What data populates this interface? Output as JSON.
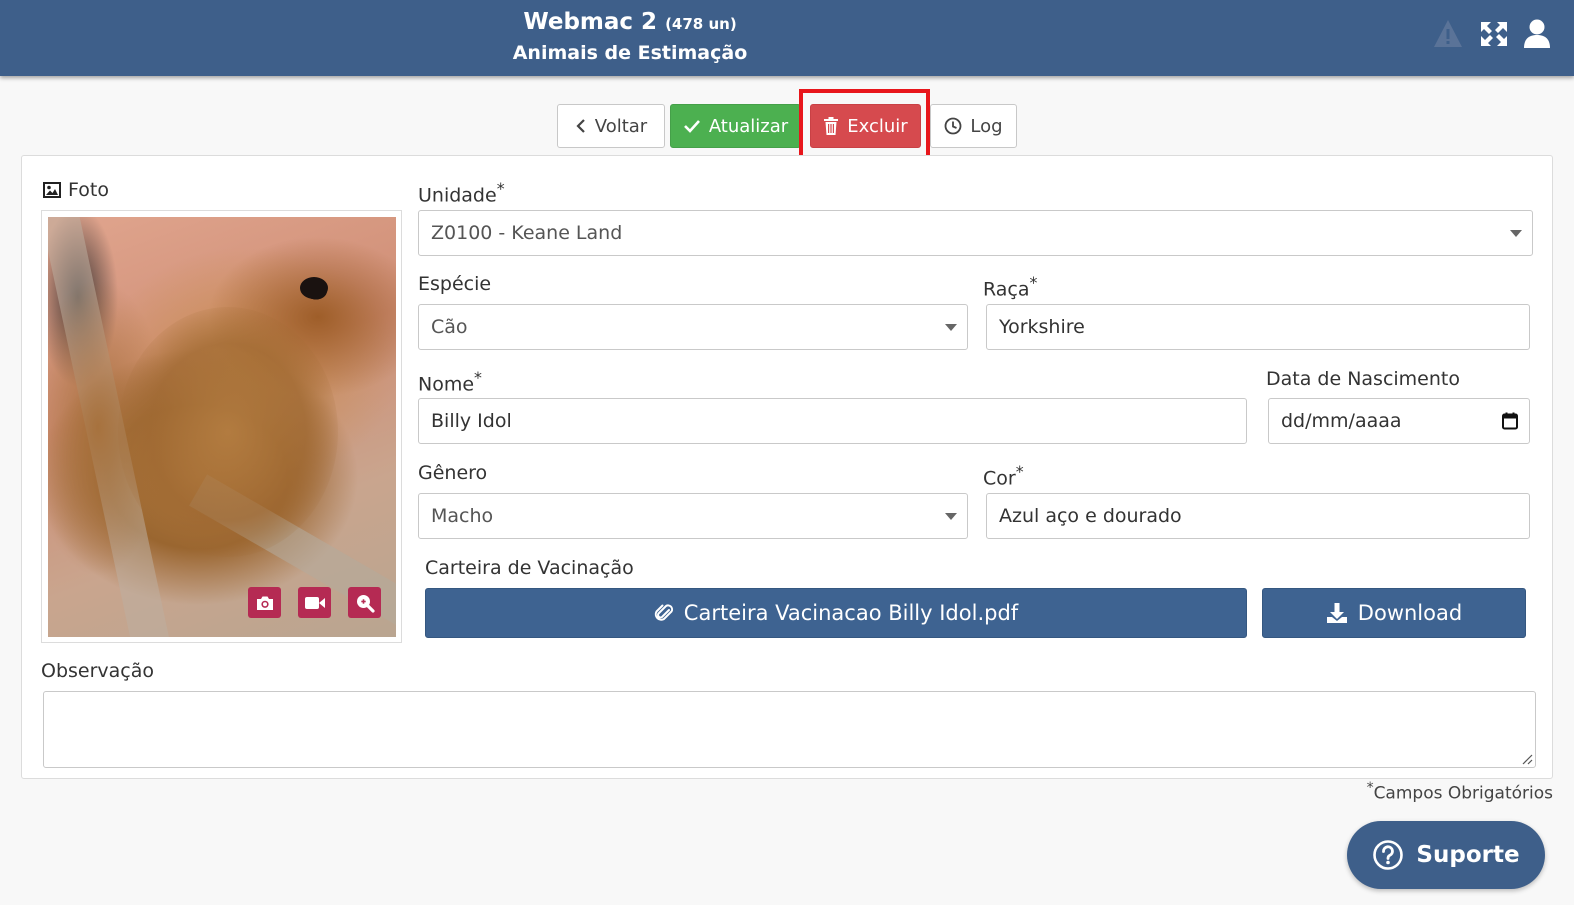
{
  "header": {
    "app_name": "Webmac 2",
    "count": "(478 un)",
    "subtitle": "Animais de Estimação",
    "icons": [
      "warning-icon",
      "fullscreen-icon",
      "user-icon"
    ]
  },
  "toolbar": {
    "back_label": "Voltar",
    "update_label": "Atualizar",
    "delete_label": "Excluir",
    "log_label": "Log"
  },
  "form": {
    "photo_label": "Foto",
    "unit_label": "Unidade",
    "unit_value": "Z0100 - Keane Land",
    "species_label": "Espécie",
    "species_value": "Cão",
    "breed_label": "Raça",
    "breed_value": "Yorkshire",
    "name_label": "Nome",
    "name_value": "Billy Idol",
    "birth_label": "Data de Nascimento",
    "birth_placeholder": "dd/mm/aaaa",
    "gender_label": "Gênero",
    "gender_value": "Macho",
    "color_label": "Cor",
    "color_value": "Azul aço e dourado",
    "vaccination_label": "Carteira de Vacinação",
    "vaccination_file": "Carteira Vacinacao Billy Idol.pdf",
    "download_label": "Download",
    "notes_label": "Observação",
    "notes_value": "",
    "required_marker": "*",
    "required_note": "Campos Obrigatórios"
  },
  "support": {
    "label": "Suporte"
  },
  "colors": {
    "header": "#3e5f8a",
    "update": "#4cb050",
    "delete": "#d64a4e",
    "highlight": "#e8161b",
    "photo_buttons": "#b52a53",
    "attachment": "#3e6391"
  }
}
